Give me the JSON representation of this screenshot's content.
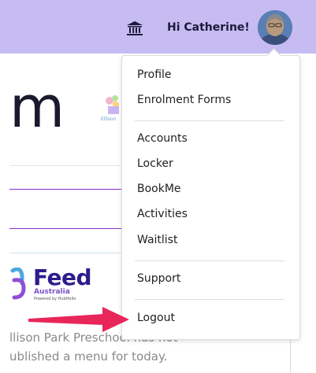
{
  "header": {
    "greeting": "Hi Catherine!",
    "icons": [
      "bank-icon",
      "user-avatar"
    ],
    "background_color": "#c6bcf2"
  },
  "background_page": {
    "big_heading_fragment": "m",
    "school_logo_text": "Ellison",
    "feed_logo": {
      "title": "Feed",
      "subtitle": "Australia",
      "powered": "Powered by HubHello"
    },
    "menu_message_lines": [
      "llison Park Preschool has not",
      "ublished a menu for today."
    ]
  },
  "dropdown": {
    "groups": [
      [
        "Profile",
        "Enrolment Forms"
      ],
      [
        "Accounts",
        "Locker",
        "BookMe",
        "Activities",
        "Waitlist"
      ],
      [
        "Support"
      ],
      [
        "Logout"
      ]
    ]
  },
  "colors": {
    "accent_purple": "#8b2fc9",
    "arrow_red": "#e8265a",
    "feed_navy": "#2b1d8c"
  }
}
